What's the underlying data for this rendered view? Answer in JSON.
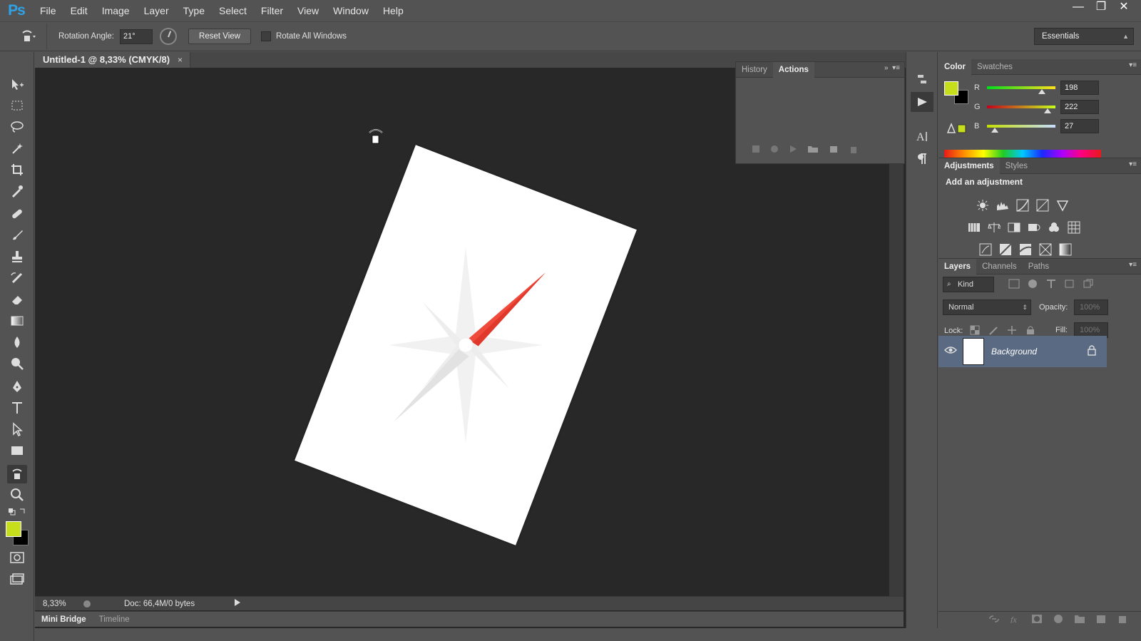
{
  "app": {
    "logo": "Ps",
    "menu": [
      "File",
      "Edit",
      "Image",
      "Layer",
      "Type",
      "Select",
      "Filter",
      "View",
      "Window",
      "Help"
    ]
  },
  "window_controls": {
    "minimize": "—",
    "restore": "❐",
    "close": "✕"
  },
  "options_bar": {
    "rotation_label": "Rotation Angle:",
    "rotation_value": "21°",
    "reset_view": "Reset View",
    "rotate_all_windows": "Rotate All Windows",
    "workspace": "Essentials"
  },
  "document": {
    "tab_title": "Untitled-1 @ 8,33% (CMYK/8)",
    "close": "×",
    "rotation_deg": 21,
    "zoom": "8,33%",
    "doc_info": "Doc: 66,4M/0 bytes"
  },
  "bottom_tabs": {
    "mini_bridge": "Mini Bridge",
    "timeline": "Timeline"
  },
  "actions_panel": {
    "tabs": [
      "History",
      "Actions"
    ],
    "active_tab": "Actions"
  },
  "color_panel": {
    "tabs": [
      "Color",
      "Swatches"
    ],
    "active_tab": "Color",
    "foreground": "#c6de1b",
    "background": "#000000",
    "channels": [
      {
        "label": "R",
        "value": "198"
      },
      {
        "label": "G",
        "value": "222"
      },
      {
        "label": "B",
        "value": "27"
      }
    ]
  },
  "adjustments_panel": {
    "tabs": [
      "Adjustments",
      "Styles"
    ],
    "active_tab": "Adjustments",
    "heading": "Add an adjustment"
  },
  "layers_panel": {
    "tabs": [
      "Layers",
      "Channels",
      "Paths"
    ],
    "active_tab": "Layers",
    "filter_kind": "Kind",
    "blend_mode": "Normal",
    "opacity_label": "Opacity:",
    "opacity_value": "100%",
    "lock_label": "Lock:",
    "fill_label": "Fill:",
    "fill_value": "100%",
    "layers": [
      {
        "name": "Background",
        "locked": true,
        "visible": true
      }
    ]
  },
  "colors": {
    "accent_logo": "#2fa3e8",
    "foreground_swatch": "#c6de1b",
    "compass_needle": "#ef4a3c",
    "selected_layer": "#596a82"
  }
}
